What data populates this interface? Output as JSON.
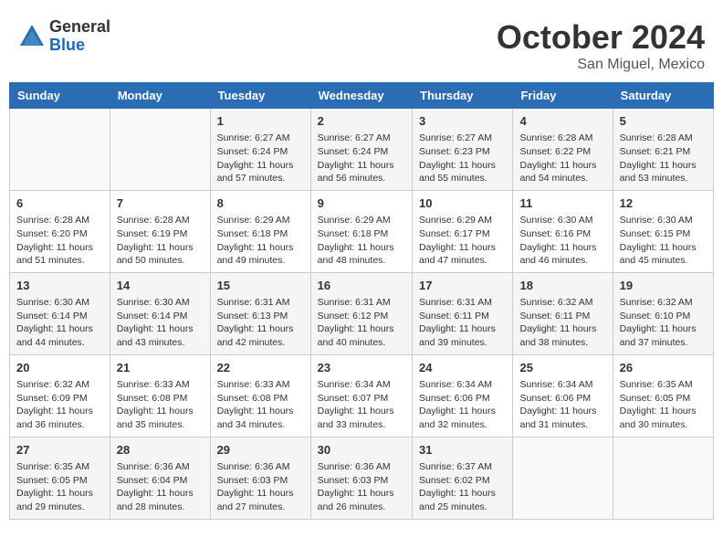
{
  "header": {
    "logo_general": "General",
    "logo_blue": "Blue",
    "month_title": "October 2024",
    "location": "San Miguel, Mexico"
  },
  "days_of_week": [
    "Sunday",
    "Monday",
    "Tuesday",
    "Wednesday",
    "Thursday",
    "Friday",
    "Saturday"
  ],
  "weeks": [
    [
      {
        "day": "",
        "sunrise": "",
        "sunset": "",
        "daylight": ""
      },
      {
        "day": "",
        "sunrise": "",
        "sunset": "",
        "daylight": ""
      },
      {
        "day": "1",
        "sunrise": "Sunrise: 6:27 AM",
        "sunset": "Sunset: 6:24 PM",
        "daylight": "Daylight: 11 hours and 57 minutes."
      },
      {
        "day": "2",
        "sunrise": "Sunrise: 6:27 AM",
        "sunset": "Sunset: 6:24 PM",
        "daylight": "Daylight: 11 hours and 56 minutes."
      },
      {
        "day": "3",
        "sunrise": "Sunrise: 6:27 AM",
        "sunset": "Sunset: 6:23 PM",
        "daylight": "Daylight: 11 hours and 55 minutes."
      },
      {
        "day": "4",
        "sunrise": "Sunrise: 6:28 AM",
        "sunset": "Sunset: 6:22 PM",
        "daylight": "Daylight: 11 hours and 54 minutes."
      },
      {
        "day": "5",
        "sunrise": "Sunrise: 6:28 AM",
        "sunset": "Sunset: 6:21 PM",
        "daylight": "Daylight: 11 hours and 53 minutes."
      }
    ],
    [
      {
        "day": "6",
        "sunrise": "Sunrise: 6:28 AM",
        "sunset": "Sunset: 6:20 PM",
        "daylight": "Daylight: 11 hours and 51 minutes."
      },
      {
        "day": "7",
        "sunrise": "Sunrise: 6:28 AM",
        "sunset": "Sunset: 6:19 PM",
        "daylight": "Daylight: 11 hours and 50 minutes."
      },
      {
        "day": "8",
        "sunrise": "Sunrise: 6:29 AM",
        "sunset": "Sunset: 6:18 PM",
        "daylight": "Daylight: 11 hours and 49 minutes."
      },
      {
        "day": "9",
        "sunrise": "Sunrise: 6:29 AM",
        "sunset": "Sunset: 6:18 PM",
        "daylight": "Daylight: 11 hours and 48 minutes."
      },
      {
        "day": "10",
        "sunrise": "Sunrise: 6:29 AM",
        "sunset": "Sunset: 6:17 PM",
        "daylight": "Daylight: 11 hours and 47 minutes."
      },
      {
        "day": "11",
        "sunrise": "Sunrise: 6:30 AM",
        "sunset": "Sunset: 6:16 PM",
        "daylight": "Daylight: 11 hours and 46 minutes."
      },
      {
        "day": "12",
        "sunrise": "Sunrise: 6:30 AM",
        "sunset": "Sunset: 6:15 PM",
        "daylight": "Daylight: 11 hours and 45 minutes."
      }
    ],
    [
      {
        "day": "13",
        "sunrise": "Sunrise: 6:30 AM",
        "sunset": "Sunset: 6:14 PM",
        "daylight": "Daylight: 11 hours and 44 minutes."
      },
      {
        "day": "14",
        "sunrise": "Sunrise: 6:30 AM",
        "sunset": "Sunset: 6:14 PM",
        "daylight": "Daylight: 11 hours and 43 minutes."
      },
      {
        "day": "15",
        "sunrise": "Sunrise: 6:31 AM",
        "sunset": "Sunset: 6:13 PM",
        "daylight": "Daylight: 11 hours and 42 minutes."
      },
      {
        "day": "16",
        "sunrise": "Sunrise: 6:31 AM",
        "sunset": "Sunset: 6:12 PM",
        "daylight": "Daylight: 11 hours and 40 minutes."
      },
      {
        "day": "17",
        "sunrise": "Sunrise: 6:31 AM",
        "sunset": "Sunset: 6:11 PM",
        "daylight": "Daylight: 11 hours and 39 minutes."
      },
      {
        "day": "18",
        "sunrise": "Sunrise: 6:32 AM",
        "sunset": "Sunset: 6:11 PM",
        "daylight": "Daylight: 11 hours and 38 minutes."
      },
      {
        "day": "19",
        "sunrise": "Sunrise: 6:32 AM",
        "sunset": "Sunset: 6:10 PM",
        "daylight": "Daylight: 11 hours and 37 minutes."
      }
    ],
    [
      {
        "day": "20",
        "sunrise": "Sunrise: 6:32 AM",
        "sunset": "Sunset: 6:09 PM",
        "daylight": "Daylight: 11 hours and 36 minutes."
      },
      {
        "day": "21",
        "sunrise": "Sunrise: 6:33 AM",
        "sunset": "Sunset: 6:08 PM",
        "daylight": "Daylight: 11 hours and 35 minutes."
      },
      {
        "day": "22",
        "sunrise": "Sunrise: 6:33 AM",
        "sunset": "Sunset: 6:08 PM",
        "daylight": "Daylight: 11 hours and 34 minutes."
      },
      {
        "day": "23",
        "sunrise": "Sunrise: 6:34 AM",
        "sunset": "Sunset: 6:07 PM",
        "daylight": "Daylight: 11 hours and 33 minutes."
      },
      {
        "day": "24",
        "sunrise": "Sunrise: 6:34 AM",
        "sunset": "Sunset: 6:06 PM",
        "daylight": "Daylight: 11 hours and 32 minutes."
      },
      {
        "day": "25",
        "sunrise": "Sunrise: 6:34 AM",
        "sunset": "Sunset: 6:06 PM",
        "daylight": "Daylight: 11 hours and 31 minutes."
      },
      {
        "day": "26",
        "sunrise": "Sunrise: 6:35 AM",
        "sunset": "Sunset: 6:05 PM",
        "daylight": "Daylight: 11 hours and 30 minutes."
      }
    ],
    [
      {
        "day": "27",
        "sunrise": "Sunrise: 6:35 AM",
        "sunset": "Sunset: 6:05 PM",
        "daylight": "Daylight: 11 hours and 29 minutes."
      },
      {
        "day": "28",
        "sunrise": "Sunrise: 6:36 AM",
        "sunset": "Sunset: 6:04 PM",
        "daylight": "Daylight: 11 hours and 28 minutes."
      },
      {
        "day": "29",
        "sunrise": "Sunrise: 6:36 AM",
        "sunset": "Sunset: 6:03 PM",
        "daylight": "Daylight: 11 hours and 27 minutes."
      },
      {
        "day": "30",
        "sunrise": "Sunrise: 6:36 AM",
        "sunset": "Sunset: 6:03 PM",
        "daylight": "Daylight: 11 hours and 26 minutes."
      },
      {
        "day": "31",
        "sunrise": "Sunrise: 6:37 AM",
        "sunset": "Sunset: 6:02 PM",
        "daylight": "Daylight: 11 hours and 25 minutes."
      },
      {
        "day": "",
        "sunrise": "",
        "sunset": "",
        "daylight": ""
      },
      {
        "day": "",
        "sunrise": "",
        "sunset": "",
        "daylight": ""
      }
    ]
  ]
}
